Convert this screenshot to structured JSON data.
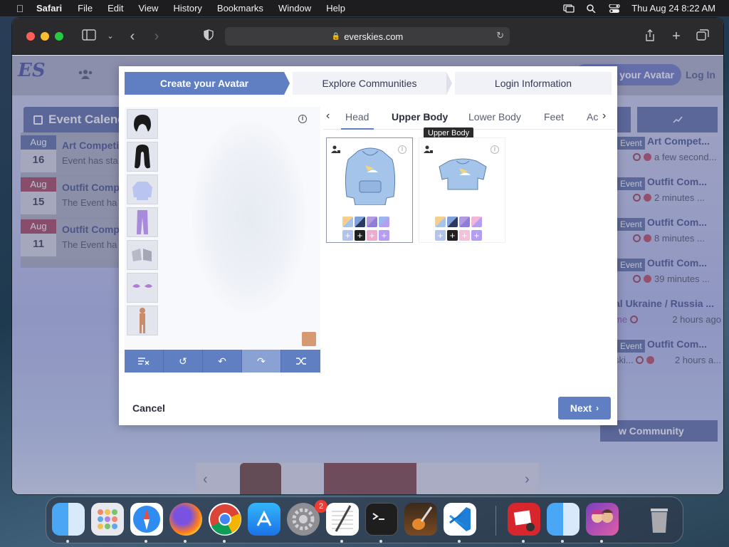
{
  "menubar": {
    "app_name": "Safari",
    "items": [
      "File",
      "Edit",
      "View",
      "History",
      "Bookmarks",
      "Window",
      "Help"
    ],
    "clock": "Thu Aug 24  8:22 AM"
  },
  "browser": {
    "url": "everskies.com"
  },
  "site": {
    "logo_text": "ES",
    "join_label": "e your Avatar",
    "login_label": "Log In",
    "calendar_title": "Event Calend",
    "calendar": [
      {
        "month": "Aug",
        "day": "16",
        "title": "Art Competit",
        "sub": "Event has sta",
        "color": "blue"
      },
      {
        "month": "Aug",
        "day": "15",
        "title": "Outfit Compe",
        "sub": "The Event ha",
        "color": "red"
      },
      {
        "month": "Aug",
        "day": "11",
        "title": "Outfit Compe",
        "sub": "The Event ha",
        "color": "red"
      }
    ],
    "feed": [
      {
        "badge": "Event",
        "title": "Art Compet...",
        "sub": "a few second..."
      },
      {
        "badge": "Event",
        "title": "Outfit Com...",
        "sub": "2 minutes ..."
      },
      {
        "badge": "Event",
        "title": "Outfit Com...",
        "sub": "8 minutes ..."
      },
      {
        "badge": "Event",
        "title": "Outfit Com...",
        "sub": "39 minutes ..."
      },
      {
        "title": "al Ukraine / Russia ...",
        "sub_left": "me",
        "sub": "2 hours ago"
      },
      {
        "badge": "Event",
        "title": "Outfit Com...",
        "sub_left": "ski...",
        "sub": "2 hours a..."
      }
    ],
    "new_community": "w Community"
  },
  "modal": {
    "steps": [
      "Create your Avatar",
      "Explore Communities",
      "Login Information"
    ],
    "categories": [
      "Head",
      "Upper Body",
      "Lower Body",
      "Feet",
      "Ac"
    ],
    "active_category": "Upper Body",
    "tooltip": "Upper Body",
    "cancel_label": "Cancel",
    "next_label": "Next",
    "skin_color": "#d59a72",
    "items": [
      {
        "name": "hoodie",
        "swatches": [
          "#f6d08a",
          "#7fa0d8",
          "#b29ae3",
          "#9ab6ee",
          "#b0c4f0",
          "#202020",
          "#f0a9d0",
          "#b59ef0"
        ]
      },
      {
        "name": "crop-top",
        "swatches": [
          "#f6d08a",
          "#7fa0d8",
          "#b29ae3",
          "#f2b7d6",
          "#b0c4f0",
          "#202020",
          "#f5c0de",
          "#b59ef0"
        ]
      }
    ]
  },
  "dock": {
    "apps": [
      "Finder",
      "Launchpad",
      "Safari",
      "Firefox",
      "Chrome",
      "App Store",
      "System Preferences",
      "TextEdit",
      "Terminal",
      "GarageBand",
      "Visual Studio Code",
      "Photo Booth",
      "Finder Alt",
      "Everskies",
      "Trash"
    ],
    "settings_badge": "2"
  }
}
